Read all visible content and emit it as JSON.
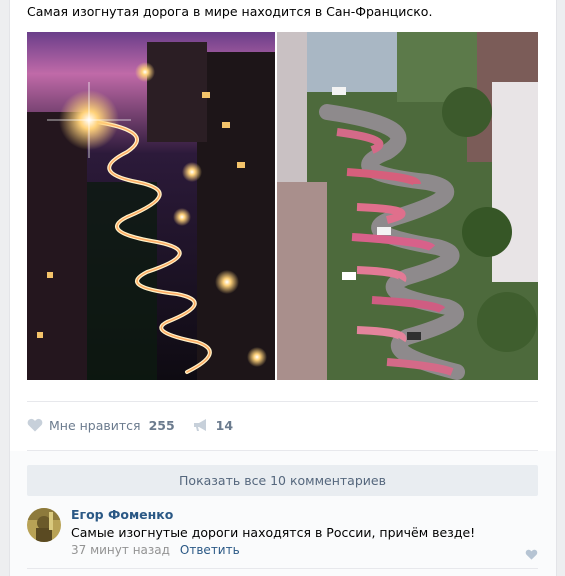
{
  "post": {
    "text": "Самая изогнутая дорога в мире находится в Сан-Франциско.",
    "photos": [
      {
        "icon": "night-street-photo"
      },
      {
        "icon": "flower-street-photo"
      }
    ]
  },
  "actions": {
    "like_label": "Мне нравится",
    "like_count": "255",
    "share_count": "14"
  },
  "comments": {
    "show_all_label": "Показать все 10 комментариев",
    "items": [
      {
        "author": "Егор Фоменко",
        "text": "Самые изогнутые дороги находятся в России, причём везде!",
        "time": "37 минут назад",
        "reply_label": "Ответить"
      }
    ]
  },
  "colors": {
    "link": "#2a5885",
    "muted": "#6b7b8e",
    "button_bg": "#e9edf1"
  }
}
